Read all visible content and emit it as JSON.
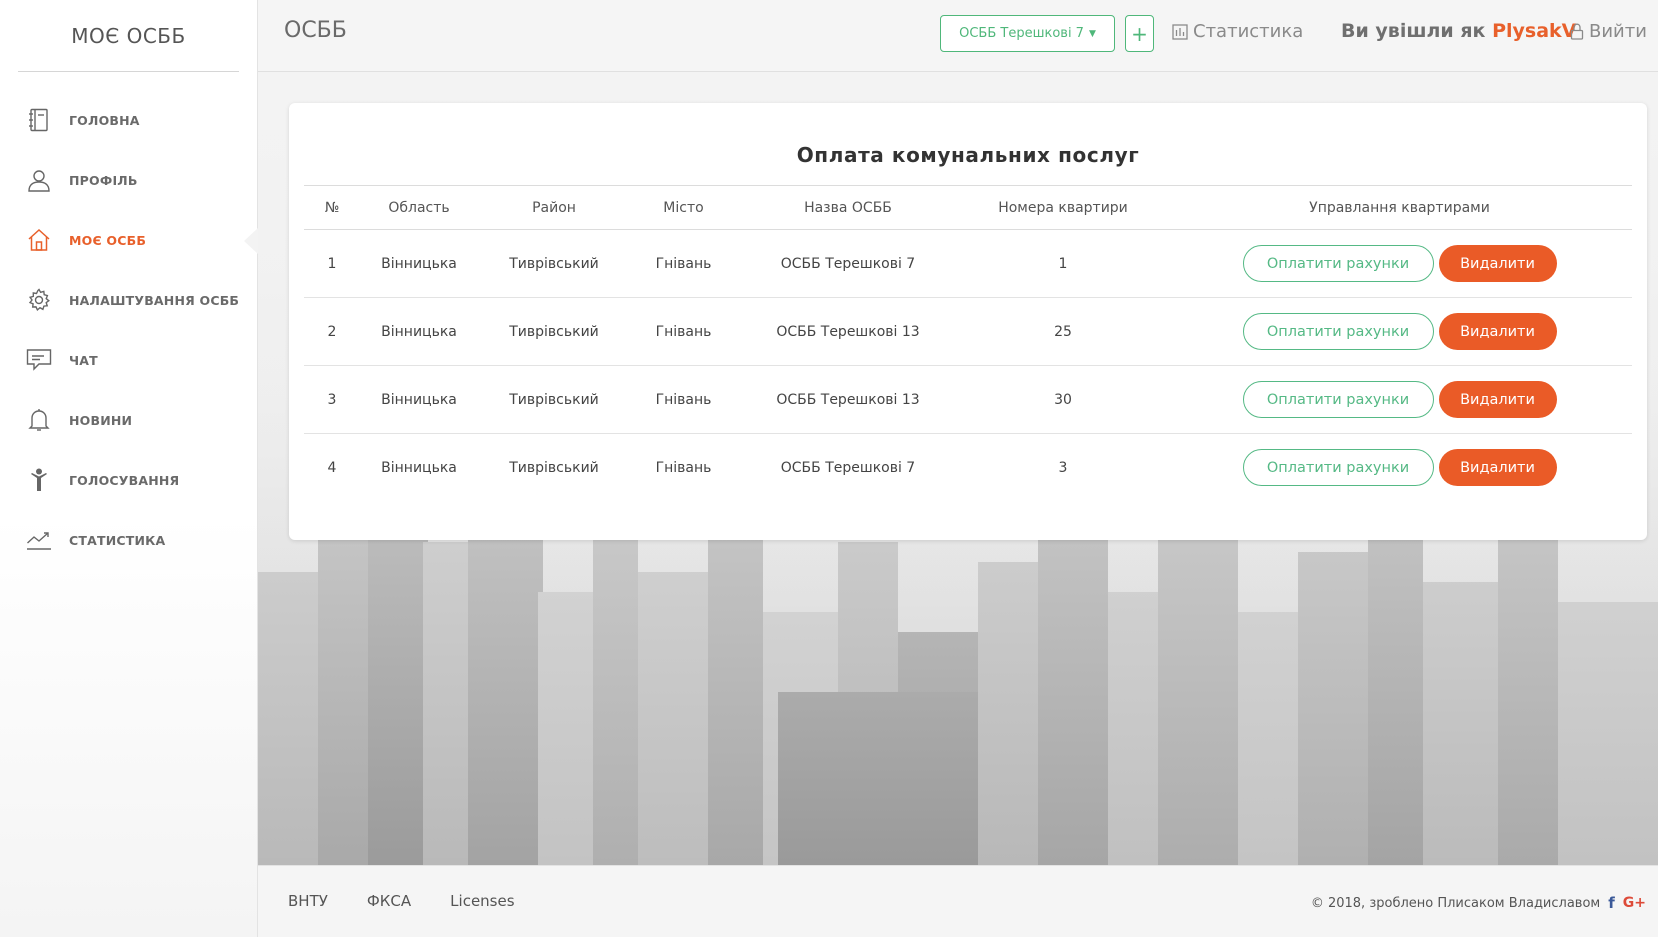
{
  "brand": "МОЄ ОСББ",
  "sidebar": {
    "items": [
      {
        "label": "ГОЛОВНА",
        "icon": "notebook-icon",
        "active": false
      },
      {
        "label": "ПРОФІЛЬ",
        "icon": "user-icon",
        "active": false
      },
      {
        "label": "МОЄ ОСББ",
        "icon": "home-icon",
        "active": true
      },
      {
        "label": "НАЛАШТУВАННЯ ОСББ",
        "icon": "gear-icon",
        "active": false
      },
      {
        "label": "ЧАТ",
        "icon": "chat-icon",
        "active": false
      },
      {
        "label": "НОВИНИ",
        "icon": "bell-icon",
        "active": false
      },
      {
        "label": "ГОЛОСУВАННЯ",
        "icon": "person-vote-icon",
        "active": false
      },
      {
        "label": "СТАТИСТИКА",
        "icon": "trend-chart-icon",
        "active": false
      }
    ]
  },
  "header": {
    "title": "ОСББ",
    "select_value": "ОСББ Терешкові 7",
    "add_label": "+",
    "stats_label": "Статистика",
    "logged_prefix": "Ви увішли як",
    "username": "PlysakV",
    "logout_label": "Вийти"
  },
  "card": {
    "title": "Оплата комунальних послуг",
    "columns": [
      "№",
      "Область",
      "Район",
      "Місто",
      "Назва ОСББ",
      "Номера квартири",
      "Управлання квартирами"
    ],
    "rows": [
      {
        "n": "1",
        "region": "Вінницька",
        "district": "Тиврівський",
        "city": "Гнівань",
        "name": "ОСББ Терешкові 7",
        "apt": "1"
      },
      {
        "n": "2",
        "region": "Вінницька",
        "district": "Тиврівський",
        "city": "Гнівань",
        "name": "ОСББ Терешкові 13",
        "apt": "25"
      },
      {
        "n": "3",
        "region": "Вінницька",
        "district": "Тиврівський",
        "city": "Гнівань",
        "name": "ОСББ Терешкові 13",
        "apt": "30"
      },
      {
        "n": "4",
        "region": "Вінницька",
        "district": "Тиврівський",
        "city": "Гнівань",
        "name": "ОСББ Терешкові 7",
        "apt": "3"
      }
    ],
    "pay_label": "Оплатити рахунки",
    "delete_label": "Видалити"
  },
  "footer": {
    "links": [
      "ВНТУ",
      "ФКСА",
      "Licenses"
    ],
    "copyright": "© 2018, зроблено Плисаком Владиславом",
    "facebook": "f",
    "googleplus": "G+"
  },
  "colors": {
    "accent": "#e8602b",
    "green": "#4fb77a",
    "delete": "#ea5b27"
  }
}
